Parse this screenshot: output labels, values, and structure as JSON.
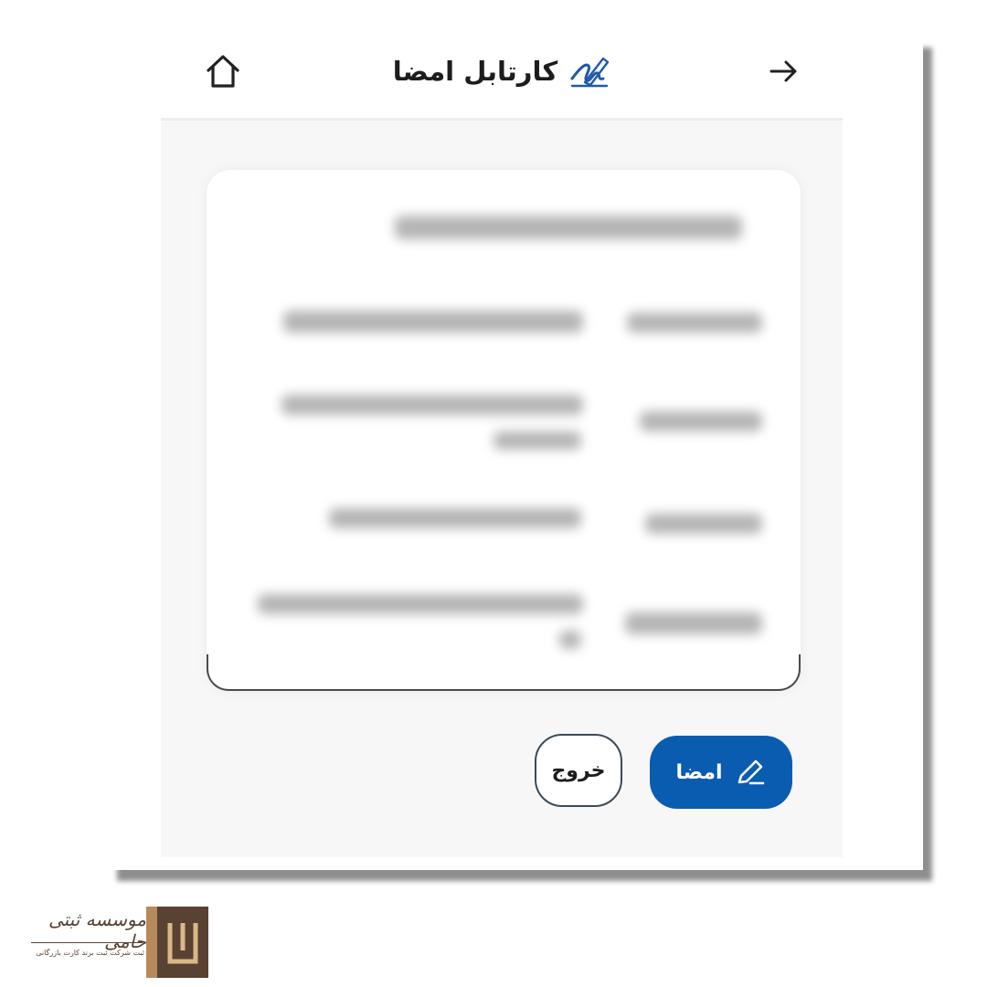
{
  "header": {
    "title": "کارتابل امضا",
    "back_icon": "arrow-right-icon",
    "home_icon": "home-icon",
    "title_icon": "signature-icon"
  },
  "card": {
    "content_obscured": true
  },
  "actions": {
    "sign_label": "امضا",
    "sign_icon": "pencil-icon",
    "exit_label": "خروج"
  },
  "watermark": {
    "name": "موسسه ثبتی حامی",
    "tagline": "ثبت شرکت ثبت برند کارت بازرگانی"
  },
  "colors": {
    "primary": "#0a5cb0",
    "title_icon": "#1e5aa8",
    "logo_brown": "#5a4232",
    "logo_tan": "#b68a5a"
  }
}
